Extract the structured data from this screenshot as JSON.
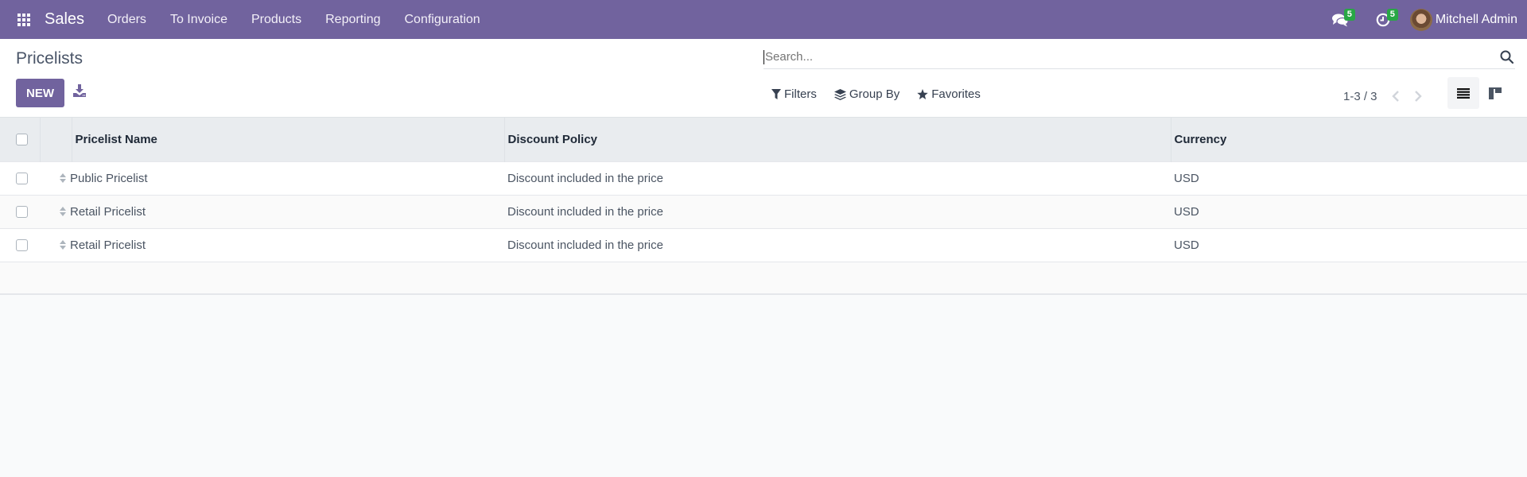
{
  "navbar": {
    "app_name": "Sales",
    "menu": [
      "Orders",
      "To Invoice",
      "Products",
      "Reporting",
      "Configuration"
    ],
    "messages_count": "5",
    "activities_count": "5",
    "user_name": "Mitchell Admin",
    "brand_color": "#71639e",
    "badge_color": "#28a745"
  },
  "control_panel": {
    "title": "Pricelists",
    "new_label": "NEW",
    "search_placeholder": "Search...",
    "filters_label": "Filters",
    "group_by_label": "Group By",
    "favorites_label": "Favorites",
    "pager_value": "1-3 / 3"
  },
  "table": {
    "columns": [
      "Pricelist Name",
      "Discount Policy",
      "Currency"
    ],
    "rows": [
      {
        "name": "Public Pricelist",
        "discount_policy": "Discount included in the price",
        "currency": "USD"
      },
      {
        "name": "Retail Pricelist",
        "discount_policy": "Discount included in the price",
        "currency": "USD"
      },
      {
        "name": "Retail Pricelist",
        "discount_policy": "Discount included in the price",
        "currency": "USD"
      }
    ]
  }
}
